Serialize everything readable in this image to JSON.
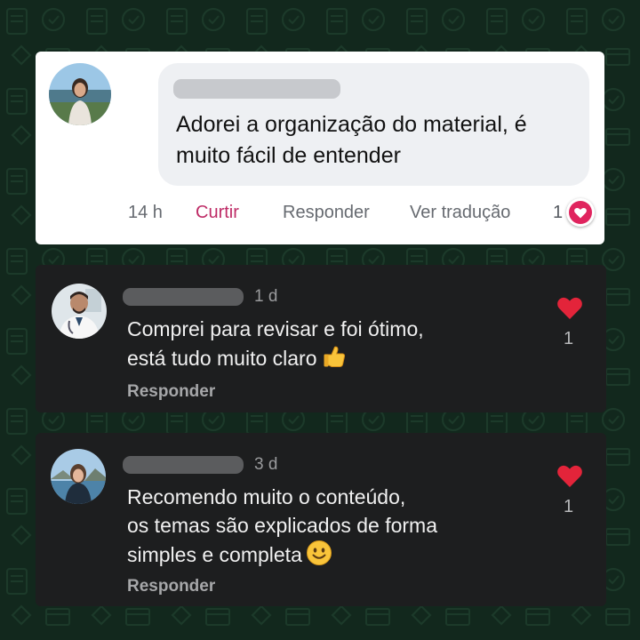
{
  "colors": {
    "background": "#12281d",
    "like_accent": "#be2b66",
    "heart_red": "#e0245e",
    "dark_card": "#1d1e1f"
  },
  "comments": [
    {
      "text": "Adorei a organização do material, é muito fácil de entender",
      "time": "14 h",
      "like_label": "Curtir",
      "reply_label": "Responder",
      "translate_label": "Ver tradução",
      "reaction_count": "1",
      "reaction_icon": "heart-icon"
    },
    {
      "time": "1 d",
      "text_line1": "Comprei para revisar e foi ótimo,",
      "text_line2": "está tudo muito claro",
      "emoji": "thumbs-up-emoji",
      "reply_label": "Responder",
      "like_count": "1",
      "reaction_icon": "heart-icon"
    },
    {
      "time": "3 d",
      "text_line1": "Recomendo muito o conteúdo,",
      "text_line2": "os temas são explicados de forma",
      "text_line3": "simples e completa",
      "emoji": "smiling-face-emoji",
      "reply_label": "Responder",
      "like_count": "1",
      "reaction_icon": "heart-icon"
    }
  ]
}
